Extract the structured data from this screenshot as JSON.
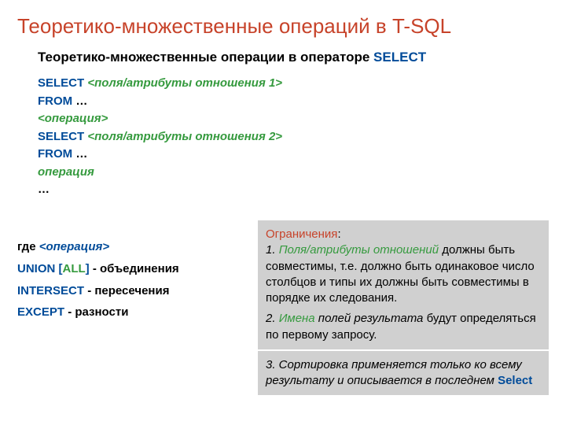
{
  "title": "Теоретико-множественные операций в T-SQL",
  "subtitle": {
    "text": "Теоретико-множественные операции в операторе ",
    "kw": "SELECT"
  },
  "syntax": {
    "l1a": "SELECT ",
    "l1b": "<поля/атрибуты отношения 1>",
    "l2a": "FROM ",
    "l2b": "…",
    "l3": "<операция>",
    "l4a": "SELECT ",
    "l4b": "<поля/атрибуты отношения 2>",
    "l5a": "FROM  ",
    "l5b": "…",
    "l6": "операция",
    "l7": "…"
  },
  "where": {
    "head_a": "где ",
    "head_b": "<операция>",
    "u1": "UNION ",
    "u1a": "[",
    "u1b": "ALL",
    "u1c": "]",
    "u1d": " - объединения",
    "i1": "INTERSECT ",
    "i1d": "- пересечения",
    "e1": "EXCEPT ",
    "e1d": "- разности"
  },
  "box1": {
    "title": "Ограничения",
    "colon": ":",
    "p1a": "1. ",
    "p1b": "Поля/атрибуты отношений",
    "p1c": " должны быть совместимы, т.е. должно быть одинаковое число столбцов и типы их должны быть совместимы в порядке их следования.",
    "p2a": " 2. ",
    "p2b": "Имена",
    "p2c": " полей результата",
    "p2d": " будут определяться по первому запросу."
  },
  "box2": {
    "p3a": " 3. Сортировка применяется только ко всему результату и описывается в последнем ",
    "p3b": "Select"
  }
}
